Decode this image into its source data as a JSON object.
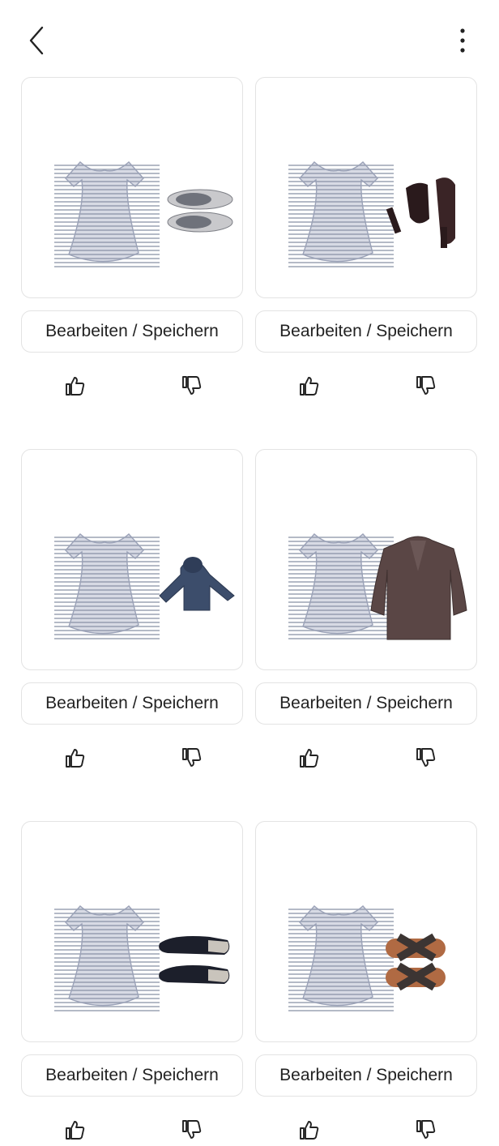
{
  "header": {
    "back_icon": "chevron-left-icon",
    "menu_icon": "more-vertical-icon"
  },
  "outfits": [
    {
      "top": "striped-dress",
      "item": "grey-sneakers",
      "action_label": "Bearbeiten / Speichern"
    },
    {
      "top": "striped-dress",
      "item": "black-heels",
      "action_label": "Bearbeiten / Speichern"
    },
    {
      "top": "striped-dress",
      "item": "navy-hoodie",
      "action_label": "Bearbeiten / Speichern"
    },
    {
      "top": "striped-dress",
      "item": "brown-coat",
      "action_label": "Bearbeiten / Speichern"
    },
    {
      "top": "striped-dress",
      "item": "black-mules",
      "action_label": "Bearbeiten / Speichern"
    },
    {
      "top": "striped-dress",
      "item": "bronze-sandals",
      "action_label": "Bearbeiten / Speichern"
    }
  ],
  "feedback": {
    "like_icon": "thumbs-up-icon",
    "dislike_icon": "thumbs-down-icon"
  }
}
